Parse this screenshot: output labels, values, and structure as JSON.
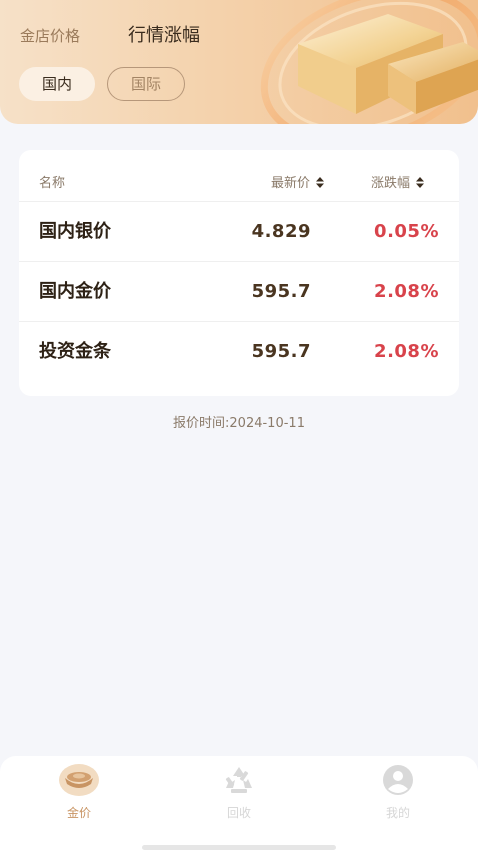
{
  "header": {
    "tabs": [
      {
        "label": "金店价格",
        "active": false
      },
      {
        "label": "行情涨幅",
        "active": true
      }
    ],
    "region_pills": [
      {
        "label": "国内",
        "selected": true
      },
      {
        "label": "国际",
        "selected": false
      }
    ]
  },
  "table": {
    "columns": {
      "name": "名称",
      "latest_price": "最新价",
      "change": "涨跌幅"
    },
    "rows": [
      {
        "name": "国内银价",
        "price": "4.829",
        "change": "0.05%"
      },
      {
        "name": "国内金价",
        "price": "595.7",
        "change": "2.08%"
      },
      {
        "name": "投资金条",
        "price": "595.7",
        "change": "2.08%"
      }
    ]
  },
  "quote_time": "报价时间:2024-10-11",
  "bottom_nav": {
    "items": [
      {
        "label": "金价",
        "icon": "gold-ingot-icon",
        "active": true
      },
      {
        "label": "回收",
        "icon": "recycle-icon",
        "active": false
      },
      {
        "label": "我的",
        "icon": "user-icon",
        "active": false
      }
    ]
  },
  "colors": {
    "accent": "#c89463",
    "positive_change": "#d8434b",
    "banner_start": "#f6e1c8",
    "banner_end": "#f1c08d",
    "background": "#f5f6fa"
  }
}
